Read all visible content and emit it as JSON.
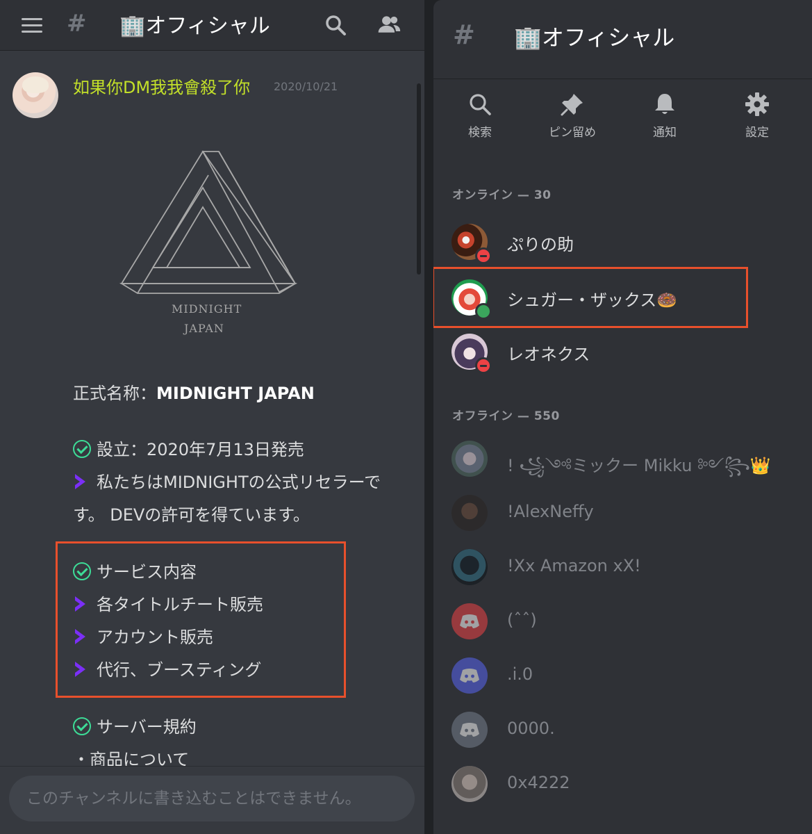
{
  "left": {
    "channel_name": "🏢オフィシャル",
    "message": {
      "author": "如果你DM我我會殺了你",
      "timestamp": "2020/10/21",
      "logo_line1": "MIDNIGHT",
      "logo_line2": "JAPAN",
      "official_name_label": "正式名称：",
      "official_name_value": "MIDNIGHT JAPAN",
      "established": "設立：2020年7月13日発売",
      "reseller_line1": "私たちはMIDNIGHTの公式リセラーで",
      "reseller_line2": "す。 DEVの許可を得ています。",
      "services_heading": "サービス内容",
      "services": [
        "各タイトルチート販売",
        "アカウント販売",
        "代行、ブースティング"
      ],
      "rules_heading": "サーバー規約",
      "products_line": "・商品について"
    },
    "composer_placeholder": "このチャンネルに書き込むことはできません。"
  },
  "right": {
    "channel_name": "🏢オフィシャル",
    "toolbar": {
      "search": "検索",
      "pins": "ピン留め",
      "notifications": "通知",
      "settings": "設定"
    },
    "online_label": "オンライン — 30",
    "offline_label": "オフライン — 550",
    "online_members": [
      {
        "name": "ぷりの助",
        "status": "dnd"
      },
      {
        "name": "シュガー・ザックス🍩",
        "status": "online"
      },
      {
        "name": "レオネクス",
        "status": "dnd"
      }
    ],
    "offline_members": [
      {
        "name": "! ꧁༺ミックー Mikku ༻꧂👑"
      },
      {
        "name": "!AlexNeffy"
      },
      {
        "name": "!Xx Amazon xX!"
      },
      {
        "name": "(ˆˆ)"
      },
      {
        "name": ".i.0"
      },
      {
        "name": "0000."
      },
      {
        "name": "0x4222"
      }
    ]
  },
  "colors": {
    "accent_highlight": "#e8502c",
    "author_color": "#c3e029",
    "check_color": "#3ddc97",
    "arrow_color": "#7b2ff7"
  }
}
